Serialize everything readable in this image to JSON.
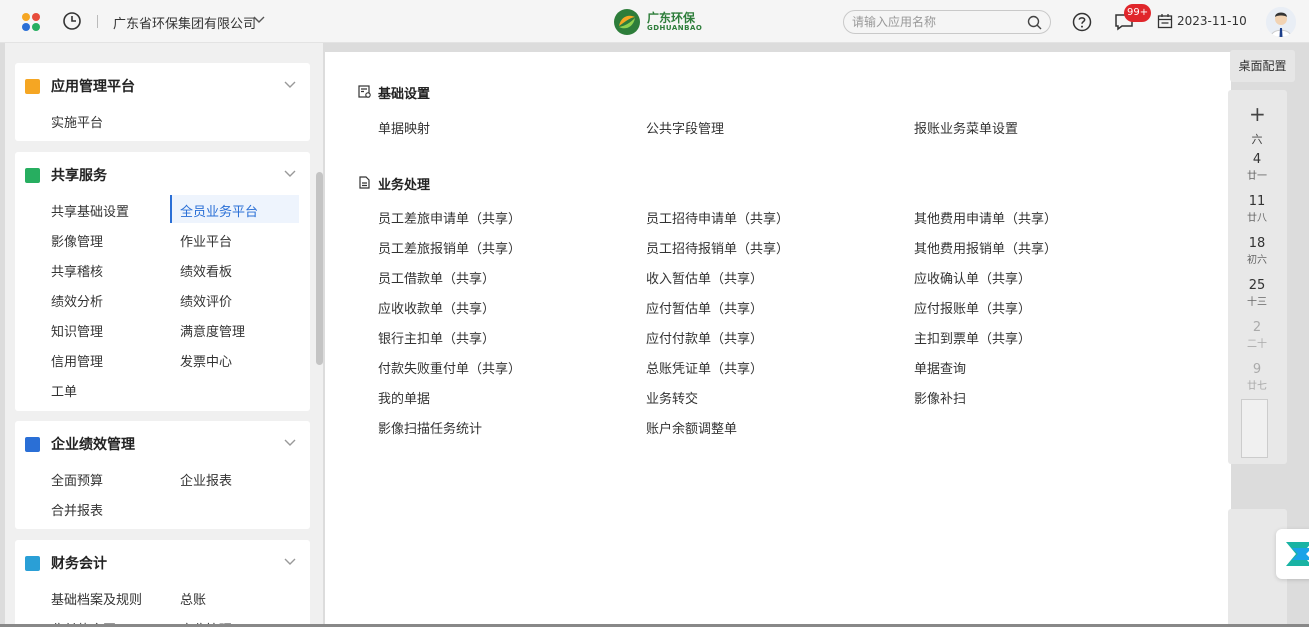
{
  "topbar": {
    "company": "广东省环保集团有限公司",
    "logo_cn": "广东环保",
    "logo_en": "GDHUANBAO",
    "search_placeholder": "请输入应用名称",
    "badge": "99+",
    "date": "2023-11-10"
  },
  "sidebar": {
    "cards": [
      {
        "title": "应用管理平台",
        "icon_color": "#f5a623",
        "items": [
          "实施平台"
        ]
      },
      {
        "title": "共享服务",
        "icon_color": "#27ae60",
        "items": [
          "共享基础设置",
          "全员业务平台",
          "影像管理",
          "作业平台",
          "共享稽核",
          "绩效看板",
          "绩效分析",
          "绩效评价",
          "知识管理",
          "满意度管理",
          "信用管理",
          "发票中心",
          "工单"
        ],
        "active": "全员业务平台"
      },
      {
        "title": "企业绩效管理",
        "icon_color": "#2a6fd6",
        "items": [
          "全面预算",
          "企业报表",
          "合并报表"
        ]
      },
      {
        "title": "财务会计",
        "icon_color": "#2a9fd6",
        "items": [
          "基础档案及规则",
          "总账",
          "收付款合同",
          "应收管理"
        ]
      }
    ]
  },
  "main": {
    "sections": [
      {
        "title": "基础设置",
        "icon": "settings-doc-icon",
        "links": [
          "单据映射",
          "公共字段管理",
          "报账业务菜单设置"
        ]
      },
      {
        "title": "业务处理",
        "icon": "document-icon",
        "links": [
          "员工差旅申请单（共享）",
          "员工招待申请单（共享）",
          "其他费用申请单（共享）",
          "员工差旅报销单（共享）",
          "员工招待报销单（共享）",
          "其他费用报销单（共享）",
          "员工借款单（共享）",
          "收入暂估单（共享）",
          "应收确认单（共享）",
          "应收收款单（共享）",
          "应付暂估单（共享）",
          "应付报账单（共享）",
          "银行主扣单（共享）",
          "应付付款单（共享）",
          "主扣到票单（共享）",
          "付款失败重付单（共享）",
          "总账凭证单（共享）",
          "单据查询",
          "我的单据",
          "业务转交",
          "影像补扫",
          "影像扫描任务统计",
          "账户余额调整单"
        ]
      }
    ]
  },
  "right": {
    "desk_config": "桌面配置",
    "calendar_add": "+",
    "weekday": "六",
    "days": [
      {
        "day": "4",
        "lunar": "廿一",
        "dim": false
      },
      {
        "day": "11",
        "lunar": "廿八",
        "dim": false
      },
      {
        "day": "18",
        "lunar": "初六",
        "dim": false
      },
      {
        "day": "25",
        "lunar": "十三",
        "dim": false
      },
      {
        "day": "2",
        "lunar": "二十",
        "dim": true
      },
      {
        "day": "9",
        "lunar": "廿七",
        "dim": true
      }
    ]
  },
  "colors": {
    "accent": "#2a6fd6",
    "badge": "#e0262b",
    "logo_green": "#2d7d3a"
  }
}
